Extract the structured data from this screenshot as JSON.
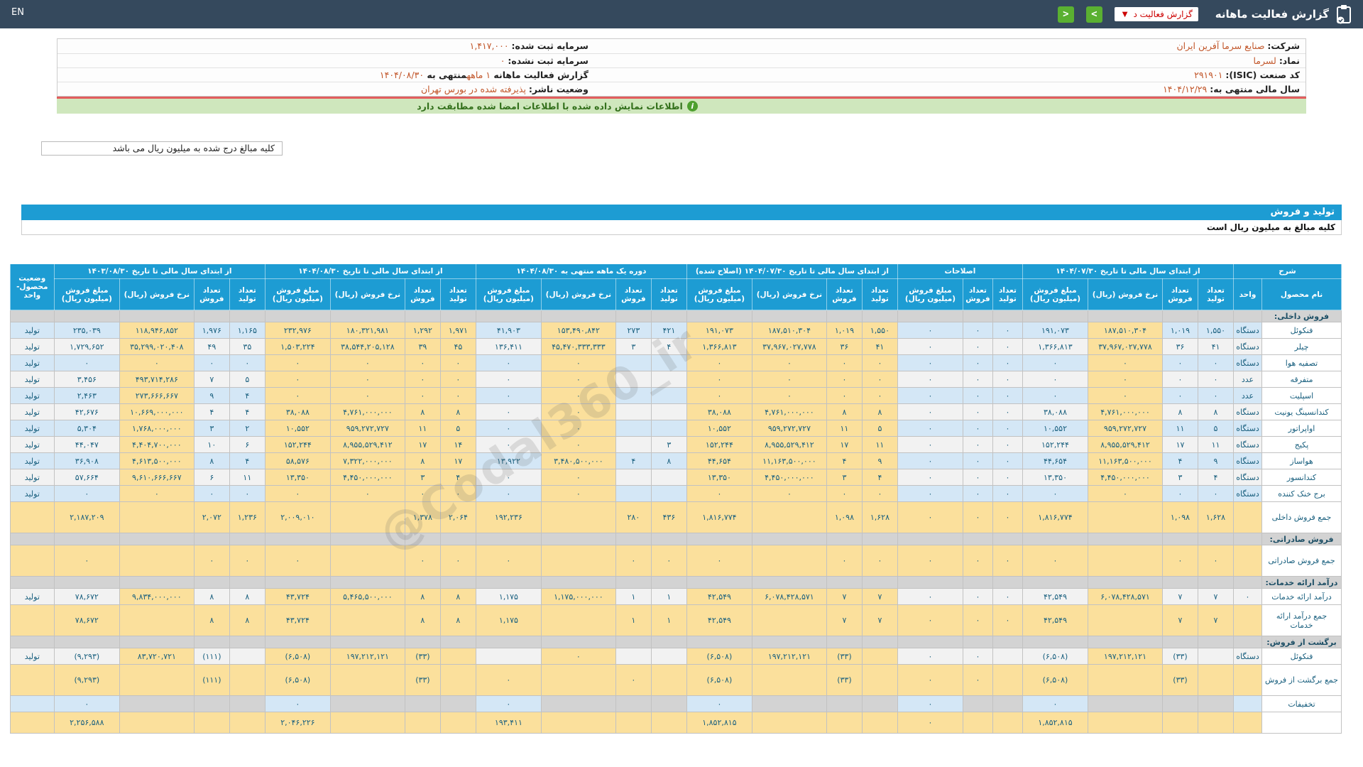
{
  "navbar": {
    "title": "گزارش فعالیت ماهانه",
    "dropdown_value": "گزارش فعالیت د",
    "prev_button": ">",
    "next_button": "<",
    "lang_switch": "EN"
  },
  "info": {
    "rows": [
      {
        "right": [
          {
            "t": "شرکت:",
            "c": "lbl"
          },
          {
            "t": " صنایع سرما آفرین ایران",
            "c": "val"
          }
        ],
        "left": [
          {
            "t": "سرمایه ثبت شده:",
            "c": "lbl"
          },
          {
            "t": " ۱,۴۱۷,۰۰۰",
            "c": "val"
          }
        ]
      },
      {
        "right": [
          {
            "t": "نماد:",
            "c": "lbl"
          },
          {
            "t": " لسرما",
            "c": "val"
          }
        ],
        "left": [
          {
            "t": "سرمایه ثبت نشده:",
            "c": "lbl"
          },
          {
            "t": " ۰",
            "c": "val"
          }
        ]
      },
      {
        "right": [
          {
            "t": "کد صنعت (ISIC):",
            "c": "lbl"
          },
          {
            "t": " ۲۹۱۹۰۱",
            "c": "val"
          }
        ],
        "left": [
          {
            "t": "گزارش فعالیت ماهانه ",
            "c": "lbl"
          },
          {
            "t": "۱ ماهه",
            "c": "val"
          },
          {
            "t": "منتهی به ",
            "c": "lbl"
          },
          {
            "t": "۱۴۰۴/۰۸/۳۰",
            "c": "val"
          }
        ]
      },
      {
        "right": [
          {
            "t": "سال مالی منتهی به:",
            "c": "lbl"
          },
          {
            "t": " ۱۴۰۴/۱۲/۲۹",
            "c": "val"
          }
        ],
        "left": [
          {
            "t": "وضعیت ناشر:",
            "c": "lbl"
          },
          {
            "t": " پذیرفته شده در بورس تهران",
            "c": "val"
          }
        ]
      }
    ]
  },
  "notice": "اطلاعات نمایش داده شده با اطلاعات امضا شده مطابقت دارد",
  "notice_icon": "i",
  "amounts_note": "کلیه مبالغ درج شده به میلیون ریال می باشد",
  "section_bar": "تولید و فروش",
  "amounts_note2": "کلیه مبالغ به میلیون ریال است",
  "watermark": "@Codal360_ir",
  "colors": {
    "navbar": "#35495d",
    "header_blue": "#1d9cd3",
    "rate_yellow": "#fbe09c",
    "stripe_blue": "#d4e7f6",
    "stripe_white": "#f2f2f2",
    "section_gray": "#d3d3d3",
    "negative_red": "#e60000",
    "value_orange": "#c2572b",
    "green_button": "#5ab031"
  },
  "table": {
    "header": {
      "desc": "شرح",
      "status_col": "وضعیت محصول-واحد",
      "groups": [
        {
          "label": "از ابتدای سال مالی تا تاریخ ۱۴۰۴/۰۷/۳۰",
          "cols": 4
        },
        {
          "label": "اصلاحات",
          "cols": 3
        },
        {
          "label": "از ابتدای سال مالی تا تاریخ ۱۴۰۴/۰۷/۳۰ (اصلاح شده)",
          "cols": 4
        },
        {
          "label": "دوره یک ماهه منتهی به ۱۴۰۴/۰۸/۳۰",
          "cols": 4
        },
        {
          "label": "از ابتدای سال مالی تا تاریخ ۱۴۰۴/۰۸/۳۰",
          "cols": 4
        },
        {
          "label": "از ابتدای سال مالی تا تاریخ ۱۴۰۳/۰۸/۳۰",
          "cols": 4
        }
      ],
      "sub": {
        "name": "نام محصول",
        "unit": "واحد",
        "prod": "تعداد تولید",
        "sold": "تعداد فروش",
        "rate": "نرخ فروش (ریال)",
        "amount": "مبلغ فروش (میلیون ریال)"
      }
    },
    "rows": [
      {
        "type": "section",
        "label": "فروش داخلی:",
        "unit": "",
        "cells": [
          "",
          "",
          "",
          "",
          "",
          "",
          "",
          "",
          "",
          "",
          "",
          "",
          "",
          "",
          "",
          "",
          "",
          "",
          "",
          "",
          "",
          "",
          ""
        ],
        "status": ""
      },
      {
        "type": "data",
        "stripe": "blue",
        "label": "فنکوئل",
        "unit": "دستگاه",
        "cells": [
          "۱,۵۵۰",
          "۱,۰۱۹",
          "۱۸۷,۵۱۰,۳۰۴",
          "۱۹۱,۰۷۳",
          "۰",
          "۰",
          "۰",
          "۱,۵۵۰",
          "۱,۰۱۹",
          "۱۸۷,۵۱۰,۳۰۴",
          "۱۹۱,۰۷۳",
          "۴۲۱",
          "۲۷۳",
          "۱۵۳,۴۹۰,۸۴۲",
          "۴۱,۹۰۳",
          "۱,۹۷۱",
          "۱,۲۹۲",
          "۱۸۰,۳۲۱,۹۸۱",
          "۲۳۲,۹۷۶",
          "۱,۱۶۵",
          "۱,۹۷۶",
          "۱۱۸,۹۴۶,۸۵۲",
          "۲۳۵,۰۳۹"
        ],
        "status": "تولید"
      },
      {
        "type": "data",
        "stripe": "white",
        "label": "چیلر",
        "unit": "دستگاه",
        "cells": [
          "۴۱",
          "۳۶",
          "۳۷,۹۶۷,۰۲۷,۷۷۸",
          "۱,۳۶۶,۸۱۳",
          "۰",
          "۰",
          "۰",
          "۴۱",
          "۳۶",
          "۳۷,۹۶۷,۰۲۷,۷۷۸",
          "۱,۳۶۶,۸۱۳",
          "۴",
          "۳",
          "۴۵,۴۷۰,۳۳۳,۳۳۳",
          "۱۳۶,۴۱۱",
          "۴۵",
          "۳۹",
          "۳۸,۵۴۴,۲۰۵,۱۲۸",
          "۱,۵۰۳,۲۲۴",
          "۳۵",
          "۴۹",
          "۳۵,۲۹۹,۰۲۰,۴۰۸",
          "۱,۷۲۹,۶۵۲"
        ],
        "status": "تولید"
      },
      {
        "type": "data",
        "stripe": "blue",
        "label": "تصفیه هوا",
        "unit": "دستگاه",
        "cells": [
          "۰",
          "۰",
          "۰",
          "۰",
          "۰",
          "۰",
          "۰",
          "۰",
          "۰",
          "۰",
          "۰",
          "",
          "",
          "۰",
          "۰",
          "۰",
          "۰",
          "۰",
          "۰",
          "۰",
          "۰",
          "۰",
          "۰"
        ],
        "status": "تولید"
      },
      {
        "type": "data",
        "stripe": "white",
        "label": "متفرقه",
        "unit": "عدد",
        "cells": [
          "۰",
          "۰",
          "۰",
          "۰",
          "۰",
          "۰",
          "۰",
          "۰",
          "۰",
          "۰",
          "۰",
          "",
          "",
          "۰",
          "۰",
          "۰",
          "۰",
          "۰",
          "۰",
          "۵",
          "۷",
          "۴۹۳,۷۱۴,۲۸۶",
          "۳,۴۵۶"
        ],
        "status": "تولید"
      },
      {
        "type": "data",
        "stripe": "blue",
        "label": "اسپلیت",
        "unit": "عدد",
        "cells": [
          "۰",
          "۰",
          "۰",
          "۰",
          "۰",
          "۰",
          "۰",
          "۰",
          "۰",
          "۰",
          "۰",
          "",
          "",
          "۰",
          "۰",
          "۰",
          "۰",
          "۰",
          "۰",
          "۴",
          "۹",
          "۲۷۳,۶۶۶,۶۶۷",
          "۲,۴۶۳"
        ],
        "status": "تولید"
      },
      {
        "type": "data",
        "stripe": "white",
        "label": "کندانسینگ یونیت",
        "unit": "دستگاه",
        "cells": [
          "۸",
          "۸",
          "۴,۷۶۱,۰۰۰,۰۰۰",
          "۳۸,۰۸۸",
          "۰",
          "۰",
          "۰",
          "۸",
          "۸",
          "۴,۷۶۱,۰۰۰,۰۰۰",
          "۳۸,۰۸۸",
          "",
          "",
          "۰",
          "۰",
          "۸",
          "۸",
          "۴,۷۶۱,۰۰۰,۰۰۰",
          "۳۸,۰۸۸",
          "۴",
          "۴",
          "۱۰,۶۶۹,۰۰۰,۰۰۰",
          "۴۲,۶۷۶"
        ],
        "status": "تولید"
      },
      {
        "type": "data",
        "stripe": "blue",
        "label": "اواپراتور",
        "unit": "دستگاه",
        "cells": [
          "۵",
          "۱۱",
          "۹۵۹,۲۷۲,۷۲۷",
          "۱۰,۵۵۲",
          "۰",
          "۰",
          "۰",
          "۵",
          "۱۱",
          "۹۵۹,۲۷۲,۷۲۷",
          "۱۰,۵۵۲",
          "",
          "",
          "۰",
          "۰",
          "۵",
          "۱۱",
          "۹۵۹,۲۷۲,۷۲۷",
          "۱۰,۵۵۲",
          "۲",
          "۳",
          "۱,۷۶۸,۰۰۰,۰۰۰",
          "۵,۳۰۴"
        ],
        "status": "تولید"
      },
      {
        "type": "data",
        "stripe": "white",
        "label": "پکیج",
        "unit": "دستگاه",
        "cells": [
          "۱۱",
          "۱۷",
          "۸,۹۵۵,۵۲۹,۴۱۲",
          "۱۵۲,۲۴۴",
          "۰",
          "۰",
          "۰",
          "۱۱",
          "۱۷",
          "۸,۹۵۵,۵۲۹,۴۱۲",
          "۱۵۲,۲۴۴",
          "۳",
          "",
          "۰",
          "۰",
          "۱۴",
          "۱۷",
          "۸,۹۵۵,۵۲۹,۴۱۲",
          "۱۵۲,۲۴۴",
          "۶",
          "۱۰",
          "۴,۴۰۴,۷۰۰,۰۰۰",
          "۴۴,۰۴۷"
        ],
        "status": "تولید"
      },
      {
        "type": "data",
        "stripe": "blue",
        "label": "هواساز",
        "unit": "دستگاه",
        "cells": [
          "۹",
          "۴",
          "۱۱,۱۶۳,۵۰۰,۰۰۰",
          "۴۴,۶۵۴",
          "۰",
          "۰",
          "۰",
          "۹",
          "۴",
          "۱۱,۱۶۳,۵۰۰,۰۰۰",
          "۴۴,۶۵۴",
          "۸",
          "۴",
          "۳,۴۸۰,۵۰۰,۰۰۰",
          "۱۳,۹۲۲",
          "۱۷",
          "۸",
          "۷,۳۲۲,۰۰۰,۰۰۰",
          "۵۸,۵۷۶",
          "۴",
          "۸",
          "۴,۶۱۳,۵۰۰,۰۰۰",
          "۳۶,۹۰۸"
        ],
        "status": "تولید"
      },
      {
        "type": "data",
        "stripe": "white",
        "label": "کندانسور",
        "unit": "دستگاه",
        "cells": [
          "۴",
          "۳",
          "۴,۴۵۰,۰۰۰,۰۰۰",
          "۱۳,۳۵۰",
          "۰",
          "۰",
          "۰",
          "۴",
          "۳",
          "۴,۴۵۰,۰۰۰,۰۰۰",
          "۱۳,۳۵۰",
          "",
          "",
          "۰",
          "۰",
          "۴",
          "۳",
          "۴,۴۵۰,۰۰۰,۰۰۰",
          "۱۳,۳۵۰",
          "۱۱",
          "۶",
          "۹,۶۱۰,۶۶۶,۶۶۷",
          "۵۷,۶۶۴"
        ],
        "status": "تولید"
      },
      {
        "type": "data",
        "stripe": "blue",
        "label": "برج خنک کننده",
        "unit": "دستگاه",
        "cells": [
          "۰",
          "۰",
          "۰",
          "۰",
          "۰",
          "۰",
          "۰",
          "۰",
          "۰",
          "۰",
          "۰",
          "",
          "",
          "۰",
          "۰",
          "۰",
          "۰",
          "۰",
          "۰",
          "۰",
          "۰",
          "۰",
          "۰"
        ],
        "status": "تولید"
      },
      {
        "type": "sum",
        "label": "جمع فروش داخلی",
        "unit": "",
        "cells": [
          "۱,۶۲۸",
          "۱,۰۹۸",
          "",
          "۱,۸۱۶,۷۷۴",
          "۰",
          "۰",
          "۰",
          "۱,۶۲۸",
          "۱,۰۹۸",
          "",
          "۱,۸۱۶,۷۷۴",
          "۴۳۶",
          "۲۸۰",
          "",
          "۱۹۲,۲۳۶",
          "۲,۰۶۴",
          "۱,۳۷۸",
          "",
          "۲,۰۰۹,۰۱۰",
          "۱,۲۳۶",
          "۲,۰۷۲",
          "",
          "۲,۱۸۷,۲۰۹"
        ],
        "status": ""
      },
      {
        "type": "section",
        "label": "فروش صادراتی:",
        "unit": "",
        "cells": [
          "",
          "",
          "",
          "",
          "",
          "",
          "",
          "",
          "",
          "",
          "",
          "",
          "",
          "",
          "",
          "",
          "",
          "",
          "",
          "",
          "",
          "",
          ""
        ],
        "status": ""
      },
      {
        "type": "sum",
        "label": "جمع فروش صادراتی",
        "unit": "",
        "cells": [
          "۰",
          "۰",
          "",
          "۰",
          "۰",
          "۰",
          "۰",
          "۰",
          "۰",
          "",
          "۰",
          "۰",
          "۰",
          "",
          "۰",
          "۰",
          "۰",
          "",
          "۰",
          "۰",
          "۰",
          "",
          "۰"
        ],
        "status": ""
      },
      {
        "type": "section",
        "label": "درآمد ارائه خدمات:",
        "unit": "",
        "cells": [
          "",
          "",
          "",
          "",
          "",
          "",
          "",
          "",
          "",
          "",
          "",
          "",
          "",
          "",
          "",
          "",
          "",
          "",
          "",
          "",
          "",
          "",
          ""
        ],
        "status": ""
      },
      {
        "type": "data",
        "stripe": "white",
        "label": "درآمد ارائه خدمات",
        "unit": "۰",
        "cells": [
          "۷",
          "۷",
          "۶,۰۷۸,۴۲۸,۵۷۱",
          "۴۲,۵۴۹",
          "۰",
          "۰",
          "۰",
          "۷",
          "۷",
          "۶,۰۷۸,۴۲۸,۵۷۱",
          "۴۲,۵۴۹",
          "۱",
          "۱",
          "۱,۱۷۵,۰۰۰,۰۰۰",
          "۱,۱۷۵",
          "۸",
          "۸",
          "۵,۴۶۵,۵۰۰,۰۰۰",
          "۴۳,۷۲۴",
          "۸",
          "۸",
          "۹,۸۳۴,۰۰۰,۰۰۰",
          "۷۸,۶۷۲"
        ],
        "status": "تولید"
      },
      {
        "type": "sum",
        "label": "جمع درآمد ارائه خدمات",
        "unit": "",
        "cells": [
          "۷",
          "۷",
          "",
          "۴۲,۵۴۹",
          "۰",
          "۰",
          "۰",
          "۷",
          "۷",
          "",
          "۴۲,۵۴۹",
          "۱",
          "۱",
          "",
          "۱,۱۷۵",
          "۸",
          "۸",
          "",
          "۴۳,۷۲۴",
          "۸",
          "۸",
          "",
          "۷۸,۶۷۲"
        ],
        "status": ""
      },
      {
        "type": "section",
        "label": "برگشت از فروش:",
        "unit": "",
        "cells": [
          "",
          "",
          "",
          "",
          "",
          "",
          "",
          "",
          "",
          "",
          "",
          "",
          "",
          "",
          "",
          "",
          "",
          "",
          "",
          "",
          "",
          "",
          ""
        ],
        "status": ""
      },
      {
        "type": "data",
        "stripe": "white",
        "label": "فنکوئل",
        "unit": "دستگاه",
        "cells": [
          "",
          "(۳۳)",
          "۱۹۷,۲۱۲,۱۲۱",
          "(۶,۵۰۸)",
          "",
          "۰",
          "۰",
          "",
          "(۳۳)",
          "۱۹۷,۲۱۲,۱۲۱",
          "(۶,۵۰۸)",
          "",
          "",
          "۰",
          "",
          "",
          "(۳۳)",
          "۱۹۷,۲۱۲,۱۲۱",
          "(۶,۵۰۸)",
          "",
          "(۱۱۱)",
          "۸۳,۷۲۰,۷۲۱",
          "(۹,۲۹۳)"
        ],
        "status": "تولید"
      },
      {
        "type": "sum",
        "label": "جمع برگشت از فروش",
        "unit": "",
        "cells": [
          "",
          "(۳۳)",
          "",
          "(۶,۵۰۸)",
          "",
          "۰",
          "۰",
          "",
          "(۳۳)",
          "",
          "(۶,۵۰۸)",
          "",
          "۰",
          "",
          "۰",
          "",
          "(۳۳)",
          "",
          "(۶,۵۰۸)",
          "",
          "(۱۱۱)",
          "",
          "(۹,۲۹۳)"
        ],
        "status": ""
      },
      {
        "type": "discount",
        "label": "تخفیفات",
        "unit": "",
        "cells": [
          "",
          "",
          "",
          "۰",
          "",
          "",
          "۰",
          "",
          "",
          "",
          "۰",
          "",
          "",
          "",
          "۰",
          "",
          "",
          "",
          "۰",
          "",
          "",
          "",
          "۰"
        ],
        "status": ""
      },
      {
        "type": "partial",
        "label": "",
        "unit": "",
        "cells": [
          "",
          "",
          "",
          "۱,۸۵۲,۸۱۵",
          "",
          "",
          "۰",
          "",
          "",
          "",
          "۱,۸۵۲,۸۱۵",
          "",
          "",
          "",
          "۱۹۳,۴۱۱",
          "",
          "",
          "",
          "۲,۰۴۶,۲۲۶",
          "",
          "",
          "",
          "۲,۲۵۶,۵۸۸"
        ],
        "status": ""
      }
    ]
  }
}
